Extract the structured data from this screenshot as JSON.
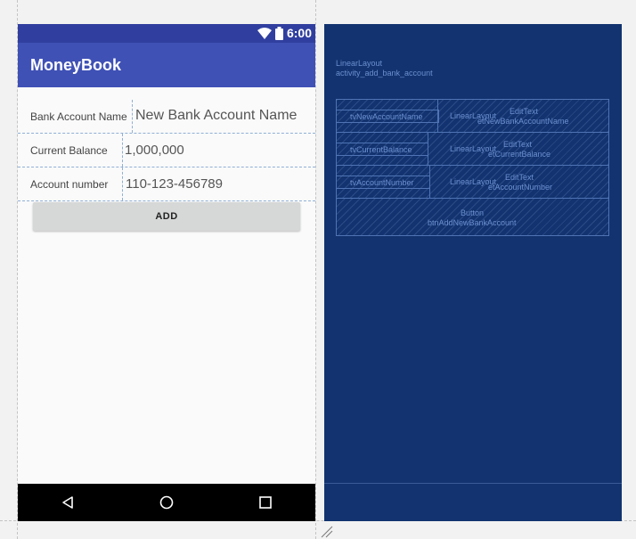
{
  "app": {
    "title": "MoneyBook",
    "status_time": "6:00"
  },
  "form": {
    "rows": [
      {
        "label": "Bank Account Name",
        "value": "New Bank Account Name"
      },
      {
        "label": "Current Balance",
        "value": "1,000,000"
      },
      {
        "label": "Account number",
        "value": "110-123-456789"
      }
    ],
    "add_label": "ADD"
  },
  "navigation": {
    "back": "back-icon",
    "home": "home-icon",
    "recents": "recents-icon"
  },
  "blueprint": {
    "root_type": "LinearLayout",
    "root_id": "activity_add_bank_account",
    "rows": [
      {
        "text_view": "tvNewAccountName",
        "layout": "LinearLayout",
        "edit_type": "EditText",
        "edit_id": "etNewBankAccountName"
      },
      {
        "text_view": "tvCurrentBalance",
        "layout": "LinearLayout",
        "edit_type": "EditText",
        "edit_id": "etCurrentBalance"
      },
      {
        "text_view": "tvAccountNumber",
        "layout": "LinearLayout",
        "edit_type": "EditText",
        "edit_id": "etAccountNumber"
      }
    ],
    "button_type": "Button",
    "button_id": "btnAddNewBankAccount"
  },
  "colors": {
    "primary": "#3f51b5",
    "primary_dark": "#303f9f",
    "blueprint_bg": "#12336f"
  }
}
